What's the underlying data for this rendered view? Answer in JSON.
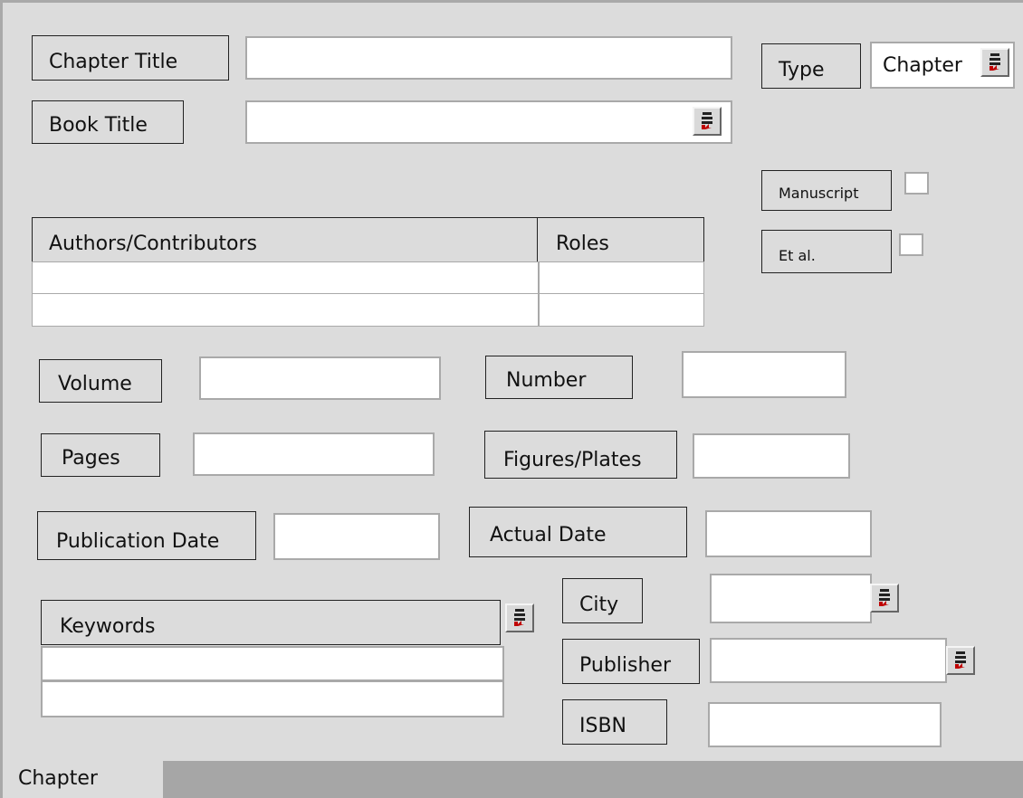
{
  "labels": {
    "chapter_title": "Chapter Title",
    "book_title": "Book Title",
    "type": "Type",
    "manuscript": "Manuscript",
    "et_al": "Et al.",
    "authors_contributors": "Authors/Contributors",
    "roles": "Roles",
    "volume": "Volume",
    "number": "Number",
    "pages": "Pages",
    "figures_plates": "Figures/Plates",
    "publication_date": "Publication Date",
    "actual_date": "Actual Date",
    "keywords": "Keywords",
    "city": "City",
    "publisher": "Publisher",
    "isbn": "ISBN"
  },
  "fields": {
    "type_value": "Chapter"
  },
  "tabs": [
    {
      "label": "Chapter"
    }
  ],
  "icons": {
    "picker": "list-picker-icon"
  }
}
